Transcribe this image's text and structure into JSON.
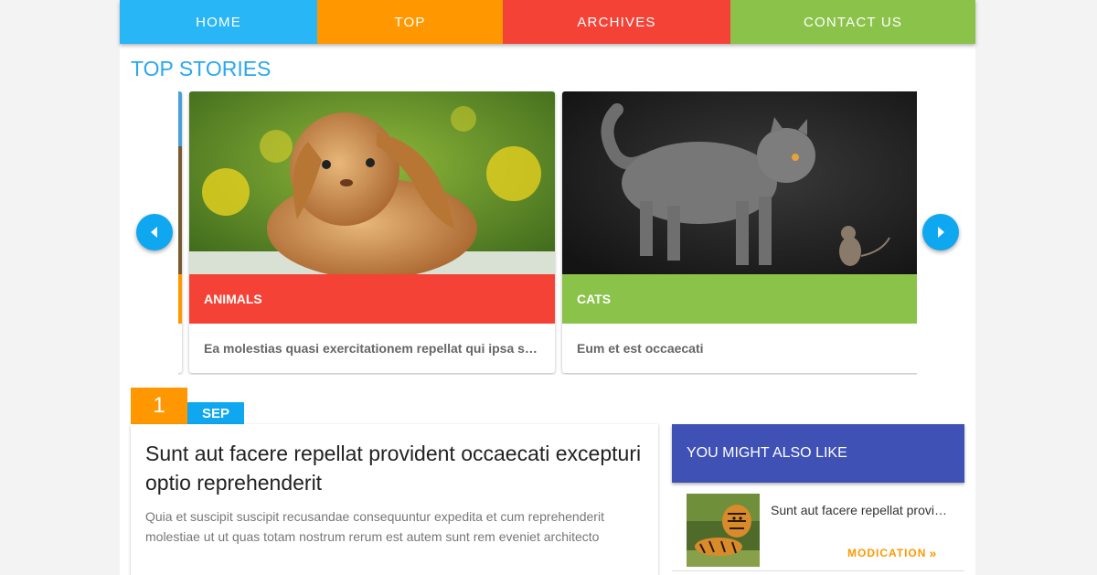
{
  "nav": {
    "items": [
      {
        "label": "HOME",
        "color": "#29b6f6"
      },
      {
        "label": "TOP",
        "color": "#ff9800"
      },
      {
        "label": "ARCHIVES",
        "color": "#f44336"
      },
      {
        "label": "CONTACT US",
        "color": "#8bc34a"
      }
    ]
  },
  "top_stories": {
    "title": "TOP STORIES",
    "cards": [
      {
        "category": "ANIMALS",
        "category_color": "#f44336",
        "text": "Ea molestias quasi exercitationem repellat qui ipsa sit aut",
        "image": "rabbit"
      },
      {
        "category": "CATS",
        "category_color": "#8bc34a",
        "text": "Eum et est occaecati",
        "image": "cat-and-mouse"
      }
    ],
    "prev_icon": "chevron-left-icon",
    "next_icon": "chevron-right-icon"
  },
  "post": {
    "day": "1",
    "month": "SEP",
    "title": "Sunt aut facere repellat provident occaecati excepturi optio reprehenderit",
    "excerpt": "Quia et suscipit suscipit recusandae consequuntur expedita et cum reprehenderit molestiae ut ut quas totam nostrum rerum est autem sunt rem eveniet architecto"
  },
  "sidebar": {
    "title": "YOU MIGHT ALSO LIKE",
    "items": [
      {
        "title": "Sunt aut facere repellat provident occaecati",
        "link_label": "MODICATION",
        "image": "tigers"
      }
    ]
  }
}
